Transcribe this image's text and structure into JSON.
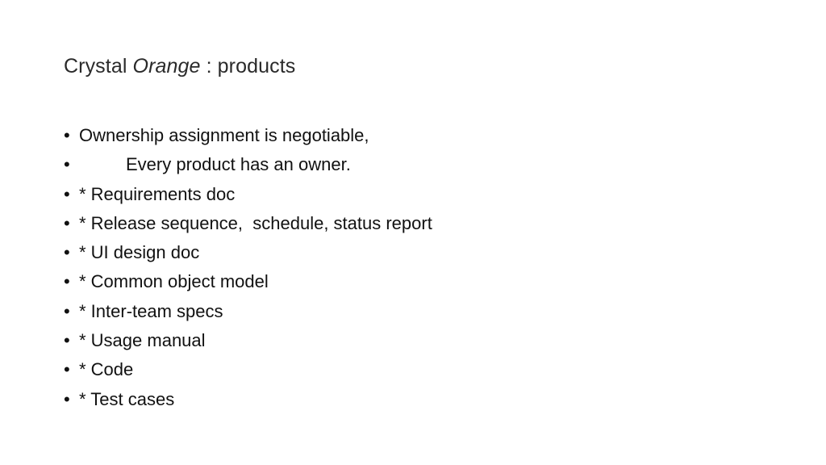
{
  "slide": {
    "title_prefix": "Crystal ",
    "title_italic": "Orange",
    "title_suffix": " : products",
    "bullet_glyph": "•",
    "bullets": [
      {
        "text": "Ownership assignment is negotiable,"
      },
      {
        "text": "Every product has an owner."
      },
      {
        "text": "* Requirements doc"
      },
      {
        "text": "* Release sequence,  schedule, status report"
      },
      {
        "text": "* UI design doc"
      },
      {
        "text": "* Common object model"
      },
      {
        "text": "* Inter-team specs"
      },
      {
        "text": "* Usage manual"
      },
      {
        "text": "* Code"
      },
      {
        "text": "* Test cases"
      }
    ]
  }
}
